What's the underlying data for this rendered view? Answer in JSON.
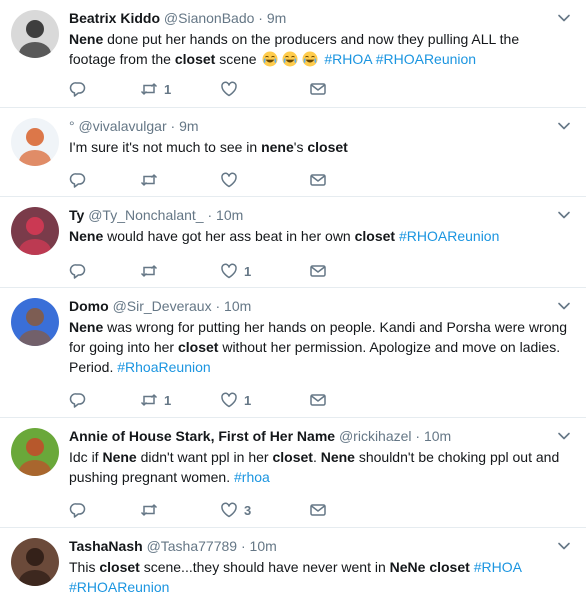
{
  "tweets": [
    {
      "name": "Beatrix Kiddo",
      "handle": "@SianonBado",
      "sep": " · ",
      "time": "9m",
      "retweets": "1",
      "likes": "",
      "segments": [
        {
          "t": "Nene",
          "s": "b"
        },
        {
          "t": " done put her hands on the producers and now they pulling ALL the footage from the ",
          "s": "n"
        },
        {
          "t": "closet",
          "s": "b"
        },
        {
          "t": " scene ",
          "s": "n"
        },
        {
          "t": "",
          "s": "emoji"
        },
        {
          "t": "",
          "s": "emoji"
        },
        {
          "t": "",
          "s": "emoji"
        },
        {
          "t": " ",
          "s": "n"
        },
        {
          "t": "#RHOA",
          "s": "h"
        },
        {
          "t": " ",
          "s": "n"
        },
        {
          "t": "#RHOAReunion",
          "s": "h"
        }
      ],
      "avatar_colors": [
        "#d9d9d9",
        "#222222"
      ]
    },
    {
      "name": "",
      "handle": "° @vivalavulgar",
      "sep": " · ",
      "time": "9m",
      "retweets": "",
      "likes": "",
      "segments": [
        {
          "t": "I'm sure it's not much to see in ",
          "s": "n"
        },
        {
          "t": "nene",
          "s": "b"
        },
        {
          "t": "'s ",
          "s": "n"
        },
        {
          "t": "closet",
          "s": "b"
        }
      ],
      "avatar_colors": [
        "#f0f4f8",
        "#d8602a"
      ]
    },
    {
      "name": "Ty",
      "handle": "@Ty_Nonchalant_",
      "sep": " · ",
      "time": "10m",
      "retweets": "",
      "likes": "1",
      "segments": [
        {
          "t": "Nene",
          "s": "b"
        },
        {
          "t": " would have got her ass beat in her own ",
          "s": "n"
        },
        {
          "t": "closet",
          "s": "b"
        },
        {
          "t": " ",
          "s": "n"
        },
        {
          "t": "#RHOAReunion",
          "s": "h"
        }
      ],
      "avatar_colors": [
        "#7a3b4a",
        "#d93a55"
      ]
    },
    {
      "name": "Domo",
      "handle": "@Sir_Deveraux",
      "sep": " · ",
      "time": "10m",
      "retweets": "1",
      "likes": "1",
      "segments": [
        {
          "t": "Nene",
          "s": "b"
        },
        {
          "t": " was wrong for putting her hands on people. Kandi and Porsha were wrong for going into her ",
          "s": "n"
        },
        {
          "t": "closet",
          "s": "b"
        },
        {
          "t": " without her permission. Apologize and move on ladies. Period. ",
          "s": "n"
        },
        {
          "t": "#RhoaReunion",
          "s": "h"
        }
      ],
      "avatar_colors": [
        "#3a6fd8",
        "#8a5a3c"
      ]
    },
    {
      "name": "Annie of House Stark, First of Her Name",
      "handle": "@rickihazel",
      "sep": " · ",
      "time": "10m",
      "retweets": "",
      "likes": "3",
      "segments": [
        {
          "t": "Idc if ",
          "s": "n"
        },
        {
          "t": "Nene",
          "s": "b"
        },
        {
          "t": " didn't want ppl in her ",
          "s": "n"
        },
        {
          "t": "closet",
          "s": "b"
        },
        {
          "t": ". ",
          "s": "n"
        },
        {
          "t": "Nene",
          "s": "b"
        },
        {
          "t": " shouldn't be choking ppl out and pushing pregnant women. ",
          "s": "n"
        },
        {
          "t": "#rhoa",
          "s": "h"
        }
      ],
      "avatar_colors": [
        "#6aa83a",
        "#c44a2a"
      ]
    },
    {
      "name": "TashaNash",
      "handle": "@Tasha77789",
      "sep": " · ",
      "time": "10m",
      "retweets": "",
      "likes": "",
      "segments": [
        {
          "t": "This ",
          "s": "n"
        },
        {
          "t": "closet",
          "s": "b"
        },
        {
          "t": " scene...they should have never went in ",
          "s": "n"
        },
        {
          "t": "NeNe",
          "s": "b"
        },
        {
          "t": " ",
          "s": "n"
        },
        {
          "t": "closet",
          "s": "b"
        },
        {
          "t": " ",
          "s": "n"
        },
        {
          "t": "#RHOA",
          "s": "h"
        },
        {
          "t": " ",
          "s": "n"
        },
        {
          "t": "#RHOAReunion",
          "s": "h"
        }
      ],
      "avatar_colors": [
        "#6b4a3a",
        "#2a1a14"
      ]
    }
  ]
}
